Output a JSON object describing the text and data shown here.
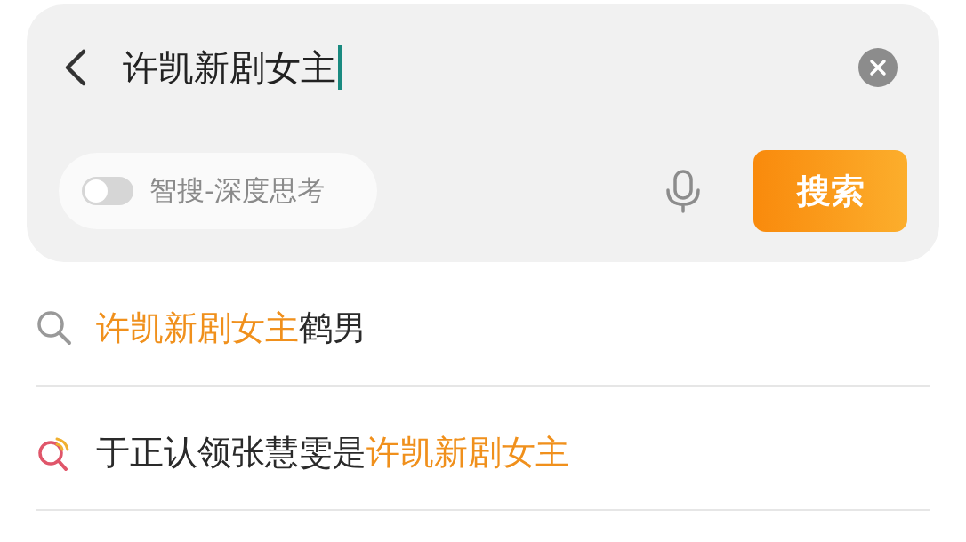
{
  "search": {
    "value": "许凯新剧女主",
    "deep_think": {
      "label": "智搜-深度思考",
      "on": false
    },
    "button": "搜索"
  },
  "suggestions": [
    {
      "kind": "search",
      "segments": [
        {
          "text": "许凯新剧女主",
          "highlight": true
        },
        {
          "text": "鹤男",
          "highlight": false
        }
      ]
    },
    {
      "kind": "hot",
      "segments": [
        {
          "text": "于正认领张慧雯是",
          "highlight": false
        },
        {
          "text": "许凯新剧女主",
          "highlight": true
        }
      ]
    }
  ]
}
